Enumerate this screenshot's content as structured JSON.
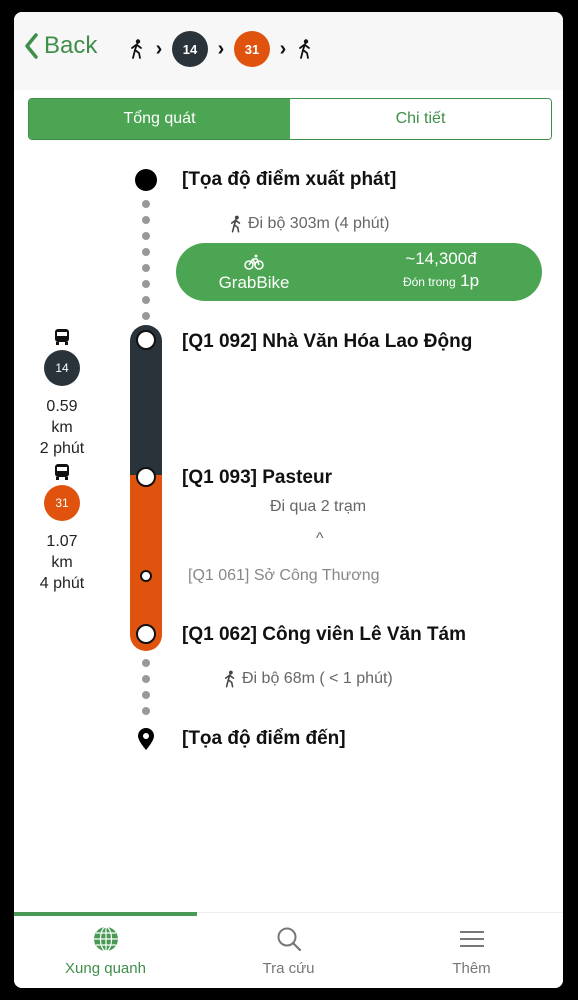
{
  "header": {
    "back_label": "Back",
    "steps": [
      {
        "type": "walk",
        "icon": "walk-icon"
      },
      {
        "type": "bus",
        "route": "14",
        "color": "#2a333a"
      },
      {
        "type": "bus",
        "route": "31",
        "color": "#e0530f"
      },
      {
        "type": "walk",
        "icon": "walk-icon"
      }
    ]
  },
  "tabs": [
    {
      "label": "Tổng quát",
      "active": true
    },
    {
      "label": "Chi tiết",
      "active": false
    }
  ],
  "route": {
    "origin": "[Tọa độ điểm xuất phát]",
    "walk_start": "Đi bộ 303m (4 phút)",
    "grab": {
      "service": "GrabBike",
      "price": "~14,300đ",
      "pickup_label": "Đón trong",
      "pickup_time": "1p"
    },
    "legs": [
      {
        "route": "14",
        "color": "#2a333a",
        "distance": "0.59 km",
        "duration": "2 phút",
        "board_stop": "[Q1 092] Nhà Văn Hóa Lao Động"
      },
      {
        "route": "31",
        "color": "#e0530f",
        "distance": "1.07 km",
        "duration": "4 phút",
        "board_stop": "[Q1 093] Pasteur",
        "pass_label": "Đi qua 2 trạm",
        "intermediate_stop": "[Q1 061] Sở Công Thương",
        "alight_stop": "[Q1 062] Công viên Lê Văn Tám"
      }
    ],
    "walk_end": "Đi bộ 68m ( < 1 phút)",
    "destination": "[Tọa độ điểm đến]"
  },
  "bottom_nav": [
    {
      "label": "Xung quanh",
      "icon": "globe-icon",
      "active": true
    },
    {
      "label": "Tra cứu",
      "icon": "search-icon",
      "active": false
    },
    {
      "label": "Thêm",
      "icon": "menu-icon",
      "active": false
    }
  ],
  "colors": {
    "accent": "#4ba552",
    "route_14": "#2a333a",
    "route_31": "#e0530f"
  }
}
